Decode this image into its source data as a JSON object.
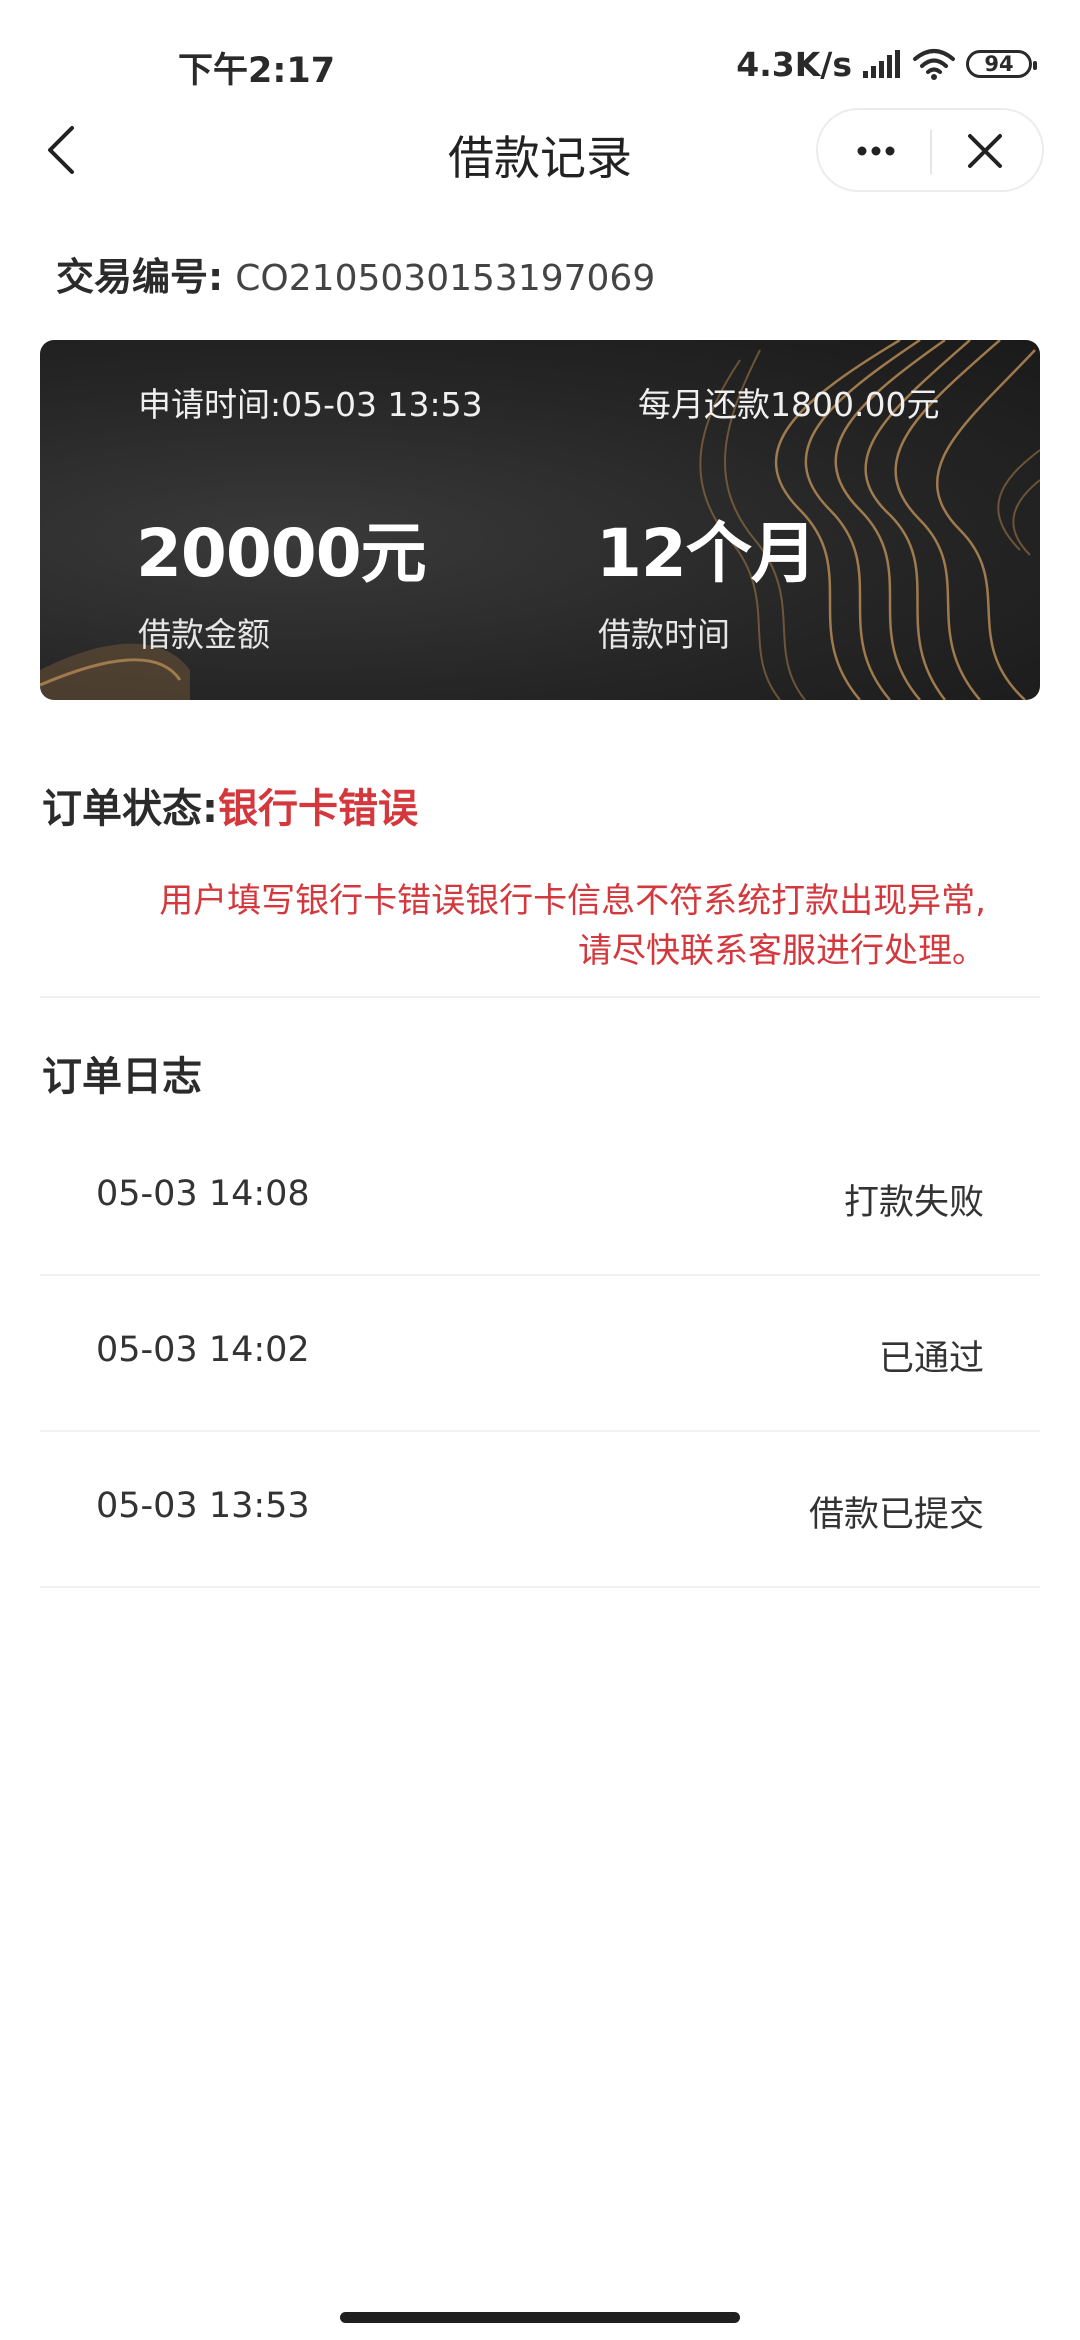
{
  "status_bar": {
    "time": "下午2:17",
    "net_speed": "4.3K/s",
    "battery": "94"
  },
  "nav": {
    "title": "借款记录",
    "back_icon": "chevron-left-icon",
    "more_icon": "more-dots-icon",
    "close_icon": "close-icon"
  },
  "transaction": {
    "label": "交易编号:",
    "number": "CO2105030153197069"
  },
  "card": {
    "apply_time": "申请时间:05-03 13:53",
    "monthly_repayment": "每月还款1800.00元",
    "amount": "20000元",
    "amount_label": "借款金额",
    "term": "12个月",
    "term_label": "借款时间"
  },
  "order": {
    "status_label": "订单状态:",
    "status_value": "银行卡错误",
    "status_note": "用户填写银行卡错误银行卡信息不符系统打款出现异常,请尽快联系客服进行处理。"
  },
  "log": {
    "title": "订单日志",
    "entries": [
      {
        "time": "05-03 14:08",
        "status": "打款失败"
      },
      {
        "time": "05-03 14:02",
        "status": "已通过"
      },
      {
        "time": "05-03 13:53",
        "status": "借款已提交"
      }
    ]
  },
  "colors": {
    "accent_red": "#d4373c",
    "card_dark": "#262626",
    "card_gold": "#b58a55"
  }
}
